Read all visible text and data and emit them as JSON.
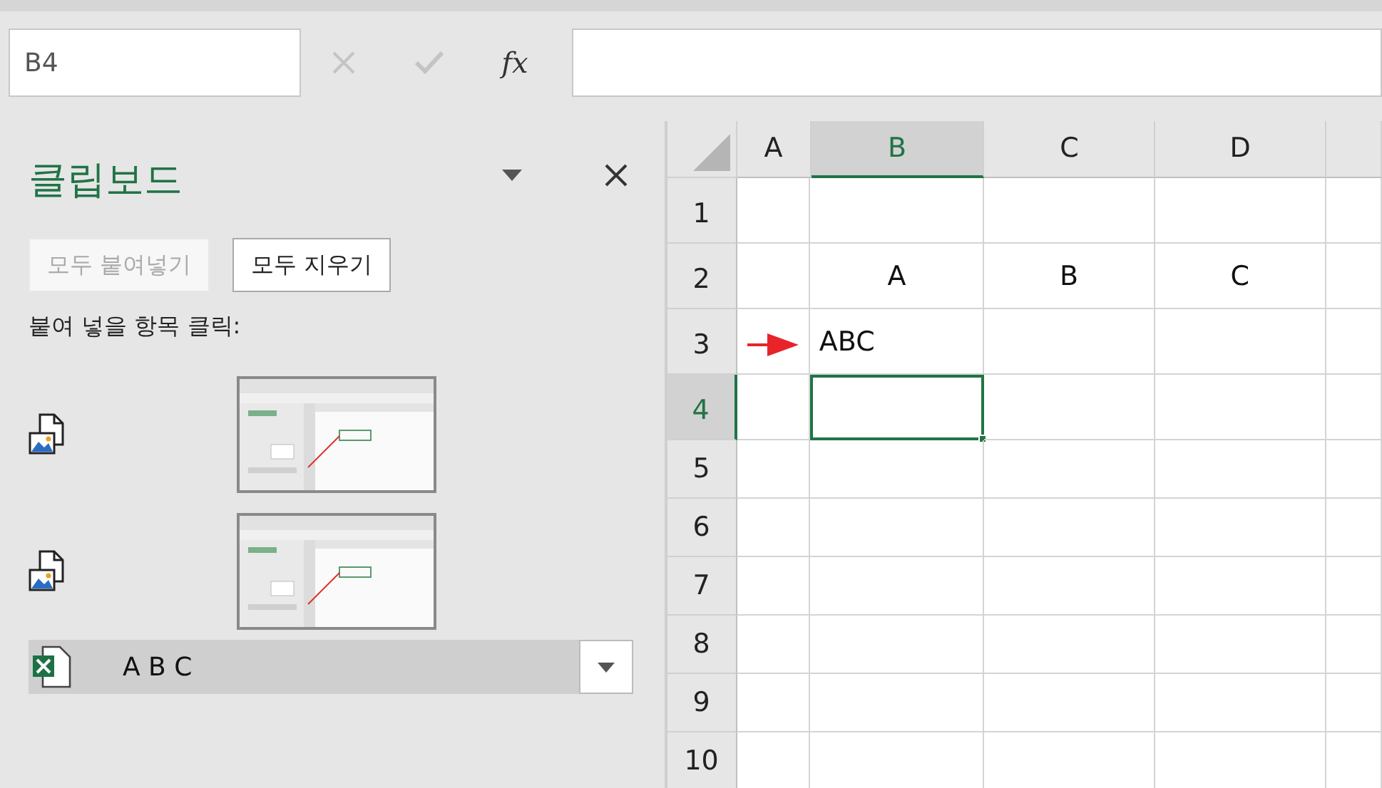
{
  "formula_bar": {
    "name_box": "B4",
    "function_label": "fx"
  },
  "clipboard_pane": {
    "title": "클립보드",
    "buttons": [
      {
        "label": "모두 붙여넣기",
        "disabled": true
      },
      {
        "label": "모두 지우기",
        "disabled": false
      }
    ],
    "instruction": "붙여 넣을 항목 클릭:",
    "items": [
      {
        "kind": "picture",
        "selected": false
      },
      {
        "kind": "picture",
        "selected": false
      },
      {
        "kind": "text",
        "text": "A B C",
        "selected": true
      }
    ]
  },
  "sheet": {
    "columns": [
      {
        "label": "A",
        "selected": false
      },
      {
        "label": "B",
        "selected": true
      },
      {
        "label": "C",
        "selected": false
      },
      {
        "label": "D",
        "selected": false
      }
    ],
    "rows": [
      {
        "label": "1",
        "selected": false,
        "cells": [
          {
            "kind": "empty",
            "selected": false
          },
          {
            "kind": "empty",
            "selected": false
          },
          {
            "kind": "empty",
            "selected": false
          },
          {
            "kind": "empty",
            "selected": false
          }
        ]
      },
      {
        "label": "2",
        "selected": false,
        "cells": [
          {
            "kind": "empty",
            "selected": false
          },
          {
            "kind": "centered",
            "text": "A",
            "selected": false
          },
          {
            "kind": "centered",
            "text": "B",
            "selected": false
          },
          {
            "kind": "centered",
            "text": "C",
            "selected": false
          }
        ]
      },
      {
        "label": "3",
        "selected": false,
        "cells": [
          {
            "kind": "arrow",
            "selected": false
          },
          {
            "kind": "text",
            "text": "ABC",
            "selected": false
          },
          {
            "kind": "empty",
            "selected": false
          },
          {
            "kind": "empty",
            "selected": false
          }
        ]
      },
      {
        "label": "4",
        "selected": true,
        "cells": [
          {
            "kind": "empty",
            "selected": false
          },
          {
            "kind": "empty",
            "selected": true
          },
          {
            "kind": "empty",
            "selected": false
          },
          {
            "kind": "empty",
            "selected": false
          }
        ]
      },
      {
        "label": "5",
        "selected": false,
        "cells": [
          {
            "kind": "empty",
            "selected": false
          },
          {
            "kind": "empty",
            "selected": false
          },
          {
            "kind": "empty",
            "selected": false
          },
          {
            "kind": "empty",
            "selected": false
          }
        ]
      },
      {
        "label": "6",
        "selected": false,
        "cells": [
          {
            "kind": "empty",
            "selected": false
          },
          {
            "kind": "empty",
            "selected": false
          },
          {
            "kind": "empty",
            "selected": false
          },
          {
            "kind": "empty",
            "selected": false
          }
        ]
      },
      {
        "label": "7",
        "selected": false,
        "cells": [
          {
            "kind": "empty",
            "selected": false
          },
          {
            "kind": "empty",
            "selected": false
          },
          {
            "kind": "empty",
            "selected": false
          },
          {
            "kind": "empty",
            "selected": false
          }
        ]
      },
      {
        "label": "8",
        "selected": false,
        "cells": [
          {
            "kind": "empty",
            "selected": false
          },
          {
            "kind": "empty",
            "selected": false
          },
          {
            "kind": "empty",
            "selected": false
          },
          {
            "kind": "empty",
            "selected": false
          }
        ]
      },
      {
        "label": "9",
        "selected": false,
        "cells": [
          {
            "kind": "empty",
            "selected": false
          },
          {
            "kind": "empty",
            "selected": false
          },
          {
            "kind": "empty",
            "selected": false
          },
          {
            "kind": "empty",
            "selected": false
          }
        ]
      },
      {
        "label": "10",
        "selected": false,
        "cells": [
          {
            "kind": "empty",
            "selected": false
          },
          {
            "kind": "empty",
            "selected": false
          },
          {
            "kind": "empty",
            "selected": false
          },
          {
            "kind": "empty",
            "selected": false
          }
        ]
      }
    ]
  }
}
